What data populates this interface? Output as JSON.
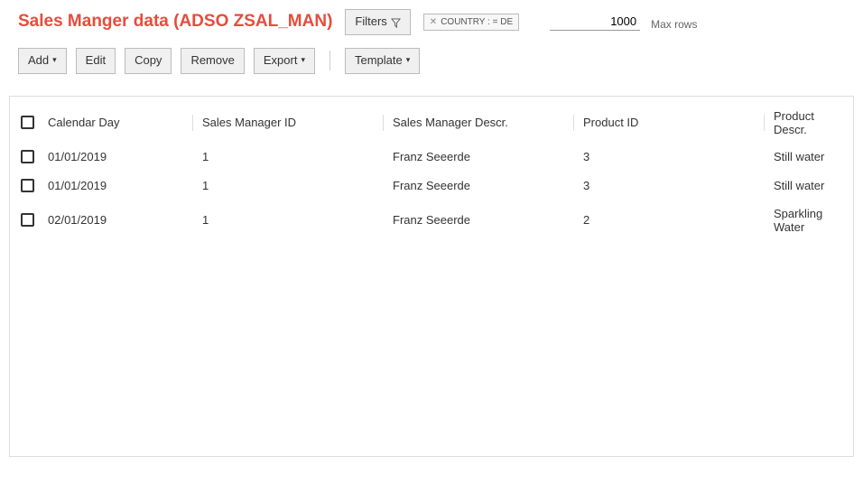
{
  "header": {
    "title": "Sales Manger data (ADSO ZSAL_MAN)",
    "filters_button": "Filters",
    "filter_chip": "COUNTRY : = DE",
    "maxrows_value": "1000",
    "maxrows_label": "Max rows"
  },
  "toolbar": {
    "add": "Add",
    "edit": "Edit",
    "copy": "Copy",
    "remove": "Remove",
    "export": "Export",
    "template": "Template"
  },
  "grid": {
    "columns": [
      "Calendar Day",
      "Sales Manager ID",
      "Sales Manager Descr.",
      "Product ID",
      "Product Descr."
    ],
    "rows": [
      {
        "day": "01/01/2019",
        "smid": "1",
        "smdesc": "Franz Seeerde",
        "pid": "3",
        "pdesc": "Still water"
      },
      {
        "day": "01/01/2019",
        "smid": "1",
        "smdesc": "Franz Seeerde",
        "pid": "3",
        "pdesc": "Still water"
      },
      {
        "day": "02/01/2019",
        "smid": "1",
        "smdesc": "Franz Seeerde",
        "pid": "2",
        "pdesc": "Sparkling Water"
      }
    ]
  }
}
